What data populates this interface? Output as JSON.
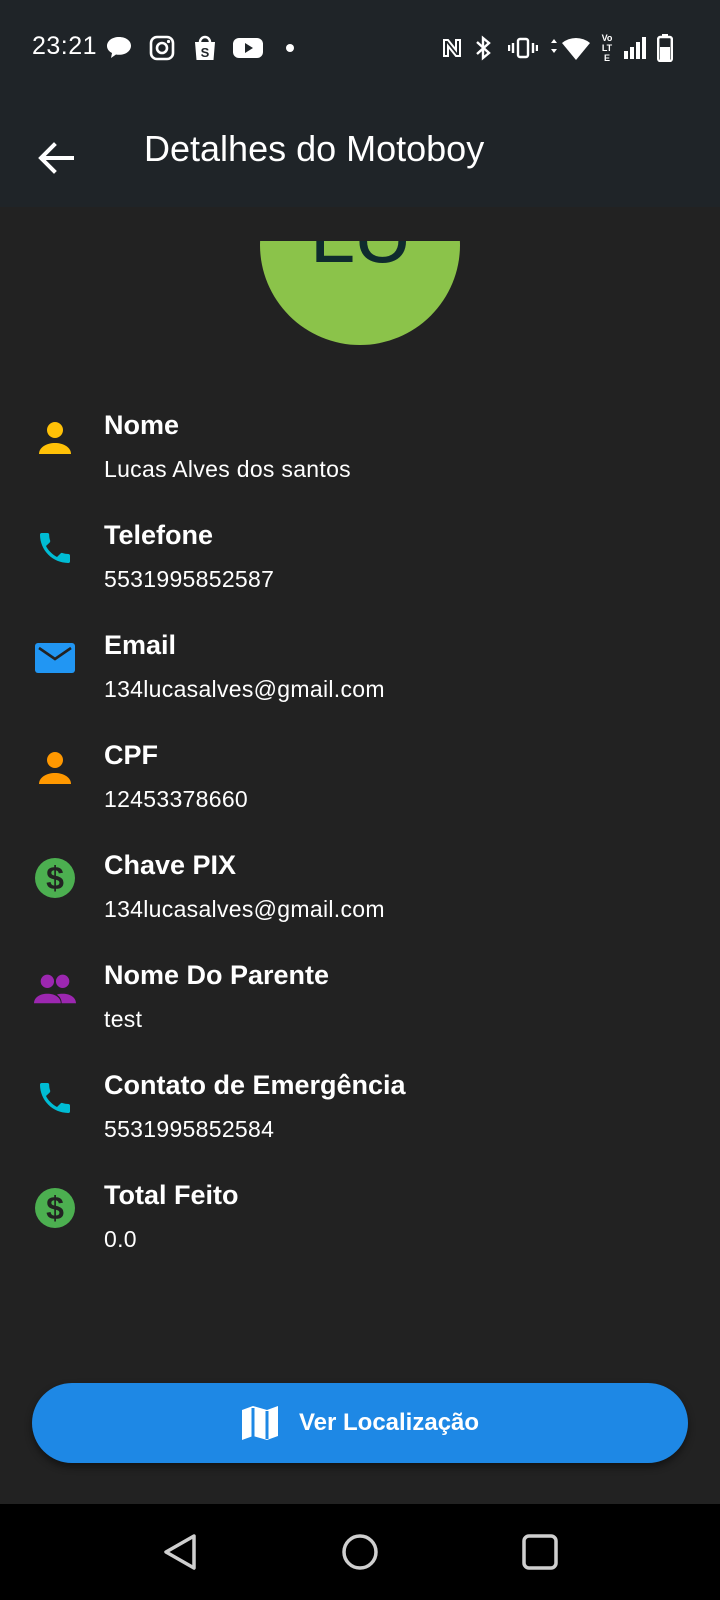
{
  "status_bar": {
    "time": "23:21",
    "icons": [
      "chat-bubble-icon",
      "instagram-icon",
      "shopee-icon",
      "youtube-icon",
      "dot-icon",
      "nfc-icon",
      "bluetooth-icon",
      "vibrate-icon",
      "wifi-icon",
      "volte-icon",
      "signal-icon",
      "battery-icon"
    ],
    "volte_text": "Vo LTE"
  },
  "app_bar": {
    "title": "Detalhes do Motoboy"
  },
  "avatar": {
    "initials": "LU",
    "color": "#8bc34a"
  },
  "fields": [
    {
      "icon": "person-icon",
      "icon_color": "#ffc107",
      "label": "Nome",
      "value": "Lucas Alves dos santos"
    },
    {
      "icon": "phone-icon",
      "icon_color": "#00bcd4",
      "label": "Telefone",
      "value": "5531995852587"
    },
    {
      "icon": "email-icon",
      "icon_color": "#2196f3",
      "label": "Email",
      "value": "134lucasalves@gmail.com"
    },
    {
      "icon": "person-icon",
      "icon_color": "#ff9800",
      "label": "CPF",
      "value": "12453378660"
    },
    {
      "icon": "dollar-icon",
      "icon_color": "#4caf50",
      "label": "Chave PIX",
      "value": "134lucasalves@gmail.com"
    },
    {
      "icon": "people-icon",
      "icon_color": "#9c27b0",
      "label": "Nome Do Parente",
      "value": "test"
    },
    {
      "icon": "phone-icon",
      "icon_color": "#00bcd4",
      "label": "Contato de Emergência",
      "value": "5531995852584"
    },
    {
      "icon": "dollar-icon",
      "icon_color": "#4caf50",
      "label": "Total Feito",
      "value": "0.0"
    }
  ],
  "location_button": {
    "label": "Ver Localização",
    "icon": "map-icon",
    "color": "#1e88e5"
  },
  "nav_bar": {
    "buttons": [
      "back-triangle-icon",
      "home-circle-icon",
      "recents-square-icon"
    ]
  }
}
